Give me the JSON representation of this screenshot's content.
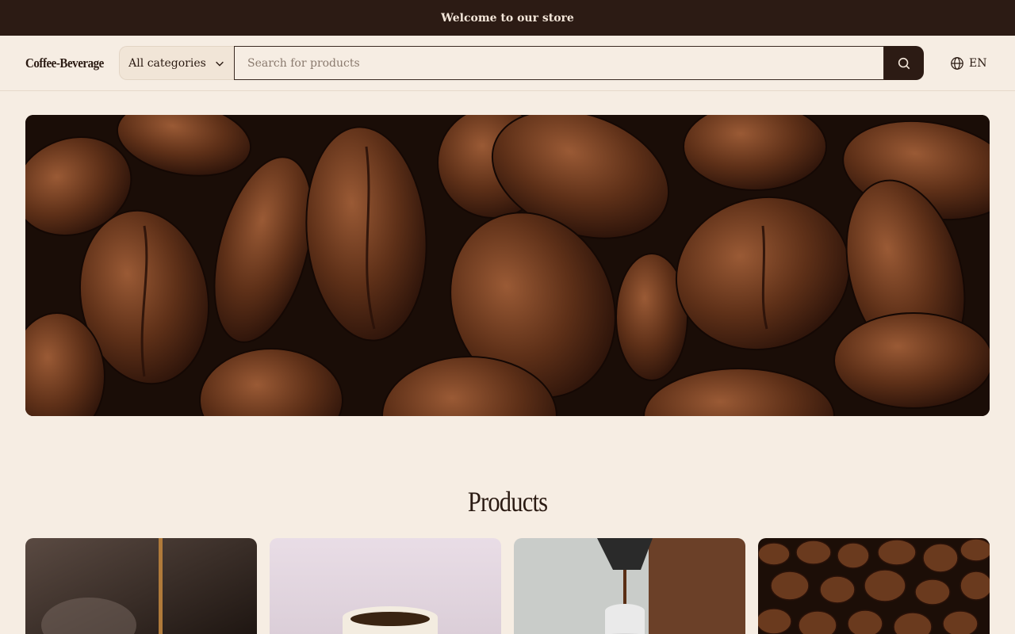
{
  "announcement": "Welcome to our store",
  "header": {
    "logo": "Coffee-Beverage",
    "category_label": "All categories",
    "search_placeholder": "Search for products",
    "language": "EN"
  },
  "hero": {
    "image": "coffee-beans-photo"
  },
  "products": {
    "title": "Products",
    "cards": [
      {
        "image": "pouring-coffee-photo"
      },
      {
        "image": "coffee-cup-photo"
      },
      {
        "image": "espresso-pour-photo"
      },
      {
        "image": "coffee-beans-photo"
      }
    ]
  },
  "colors": {
    "background": "#f6ede3",
    "dark": "#2c1b14",
    "text": "#2a1a12"
  }
}
